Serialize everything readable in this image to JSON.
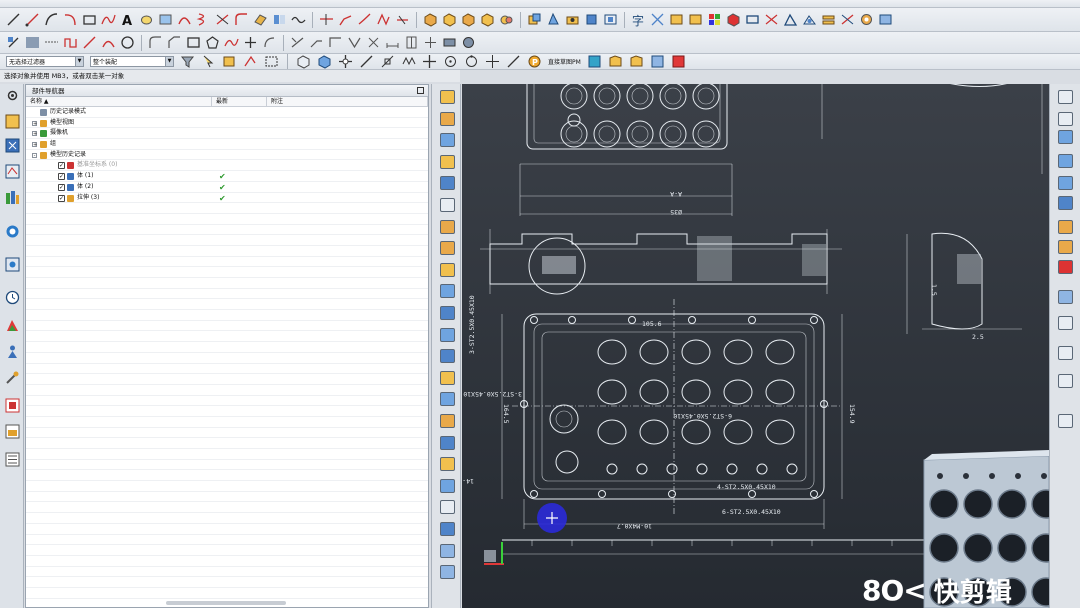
{
  "toolbar": {
    "filter_select": "无选择过滤器",
    "scope_select": "整个装配",
    "snap_label": "直接草图PM"
  },
  "status": {
    "prompt": "选择对象并使用 MB3，或者双击某一对象"
  },
  "navigator": {
    "title": "部件导航器",
    "columns": [
      "名称",
      "最新",
      "附注"
    ],
    "rows": [
      {
        "label": "历史记录模式",
        "indent": 0,
        "expand": "",
        "checked": false
      },
      {
        "label": "模型视图",
        "indent": 0,
        "expand": "+",
        "checked": false
      },
      {
        "label": "摄像机",
        "indent": 0,
        "expand": "+",
        "checked": false
      },
      {
        "label": "组",
        "indent": 0,
        "expand": "+",
        "checked": false
      },
      {
        "label": "模型历史记录",
        "indent": 0,
        "expand": "-",
        "checked": false
      },
      {
        "label": "基准坐标系 (0)",
        "indent": 1,
        "expand": "",
        "checked": true
      },
      {
        "label": "体 (1)",
        "indent": 1,
        "expand": "",
        "checked": true
      },
      {
        "label": "体 (2)",
        "indent": 1,
        "expand": "",
        "checked": true
      },
      {
        "label": "拉伸 (3)",
        "indent": 1,
        "expand": "",
        "checked": true
      }
    ]
  },
  "drawing": {
    "dims": [
      "3-ST2.5X0.45X10",
      "3-ST2.5X0.45X10",
      "6-ST2.5X0.45X10",
      "4-ST2.5X0.45X10",
      "6-ST2.5X0.45X10",
      "14-M3X0.5",
      "10-M4X0.7",
      "154.9",
      "164.5",
      "105.6",
      "A-A",
      "Ø35",
      "1.5",
      "2.5"
    ]
  },
  "watermark": {
    "logo": "8O<",
    "text": "快剪辑"
  },
  "colors": {
    "canvas_top": "#3b4048",
    "canvas_bottom": "#252a31",
    "line": "#e8edf2",
    "check": "#2e9a2e",
    "marker": "#2a2ad8"
  }
}
